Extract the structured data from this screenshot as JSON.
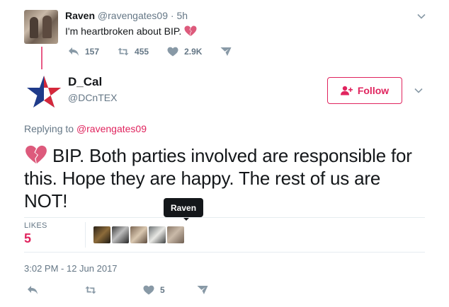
{
  "parent_tweet": {
    "name": "Raven",
    "handle": "@ravengates09",
    "separator": "·",
    "time": "5h",
    "text": "I'm heartbroken about BIP.",
    "emoji_icon": "broken-heart-icon",
    "actions": {
      "reply_count": "157",
      "retweet_count": "455",
      "like_count": "2.9K"
    }
  },
  "main_tweet": {
    "name": "D_Cal",
    "handle": "@DCnTEX",
    "follow_label": "Follow",
    "replying_prefix": "Replying to",
    "replying_to": "@ravengates09",
    "text": "BIP.  Both parties involved are responsible for this.  Hope they are happy.  The rest of us are NOT!",
    "emoji_icon": "broken-heart-icon",
    "tooltip": "Raven",
    "likes_label": "LIKES",
    "likes_count": "5",
    "timestamp": "3:02 PM - 12 Jun 2017",
    "actions": {
      "like_count": "5"
    }
  },
  "colors": {
    "accent": "#e0245e",
    "secondary_text": "#657786",
    "icon_gray": "#8899a6",
    "divider": "#e6ecf0"
  }
}
